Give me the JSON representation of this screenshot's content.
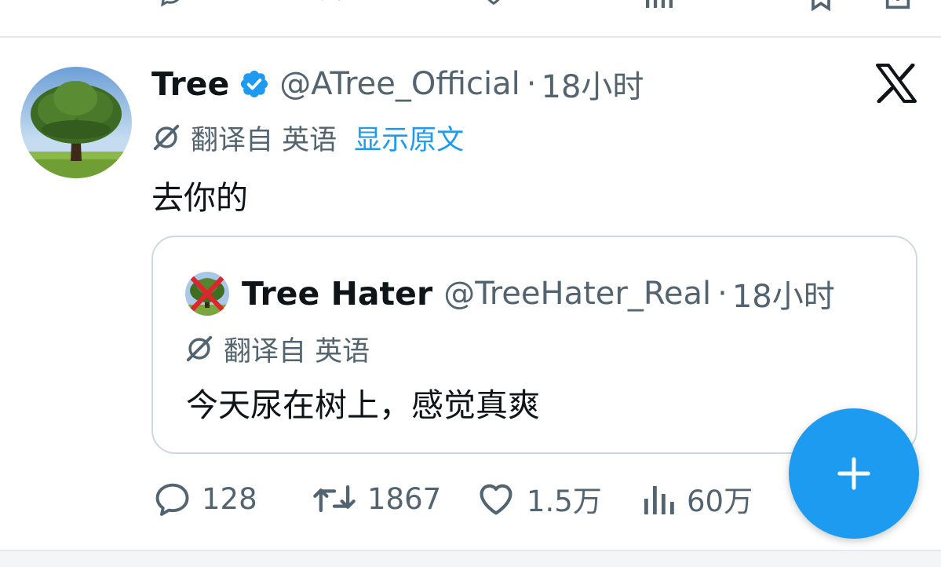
{
  "tweet": {
    "author_name": "Tree",
    "handle": "@ATree_Official",
    "separator": "·",
    "time": "18小时",
    "translation": {
      "label": "翻译自 英语",
      "show_original": "显示原文"
    },
    "text": "去你的",
    "verified": true
  },
  "quoted": {
    "author_name": "Tree Hater",
    "handle": "@TreeHater_Real",
    "separator": "·",
    "time": "18小时",
    "translation": {
      "label": "翻译自 英语"
    },
    "text": "今天尿在树上，感觉真爽"
  },
  "actions": {
    "replies": "128",
    "retweets": "1867",
    "likes": "1.5万",
    "views": "60万"
  },
  "icons": {
    "verified": "verified-badge-icon",
    "x_logo": "x-logo-icon",
    "translate": "translate-icon",
    "reply": "reply-icon",
    "retweet": "retweet-icon",
    "like": "heart-icon",
    "views": "views-icon",
    "compose": "plus-icon"
  },
  "colors": {
    "accent": "#1d9bf0",
    "text_primary": "#0f1419",
    "text_secondary": "#536471",
    "border": "#cfd9de"
  }
}
